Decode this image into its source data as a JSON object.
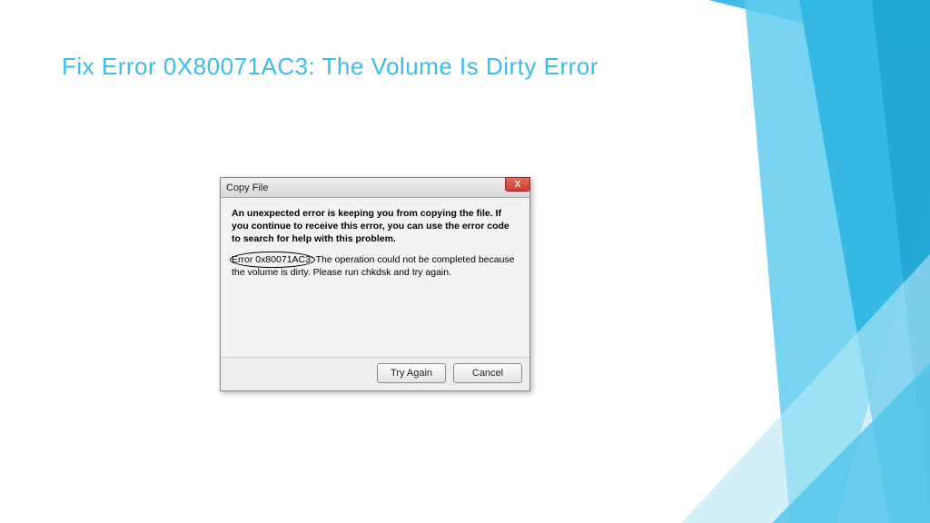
{
  "slide": {
    "title": "Fix Error 0X80071AC3: The Volume Is Dirty Error"
  },
  "dialog": {
    "title": "Copy File",
    "message": "An unexpected error is keeping you from copying the file. If you continue to receive this error, you can use the error code to search for help with this problem.",
    "error_code": "Error 0x80071AC3:",
    "error_detail": " The operation could not be completed because the volume is dirty. Please run chkdsk and try again.",
    "buttons": {
      "try_again": "Try Again",
      "cancel": "Cancel"
    },
    "close_symbol": "X"
  }
}
